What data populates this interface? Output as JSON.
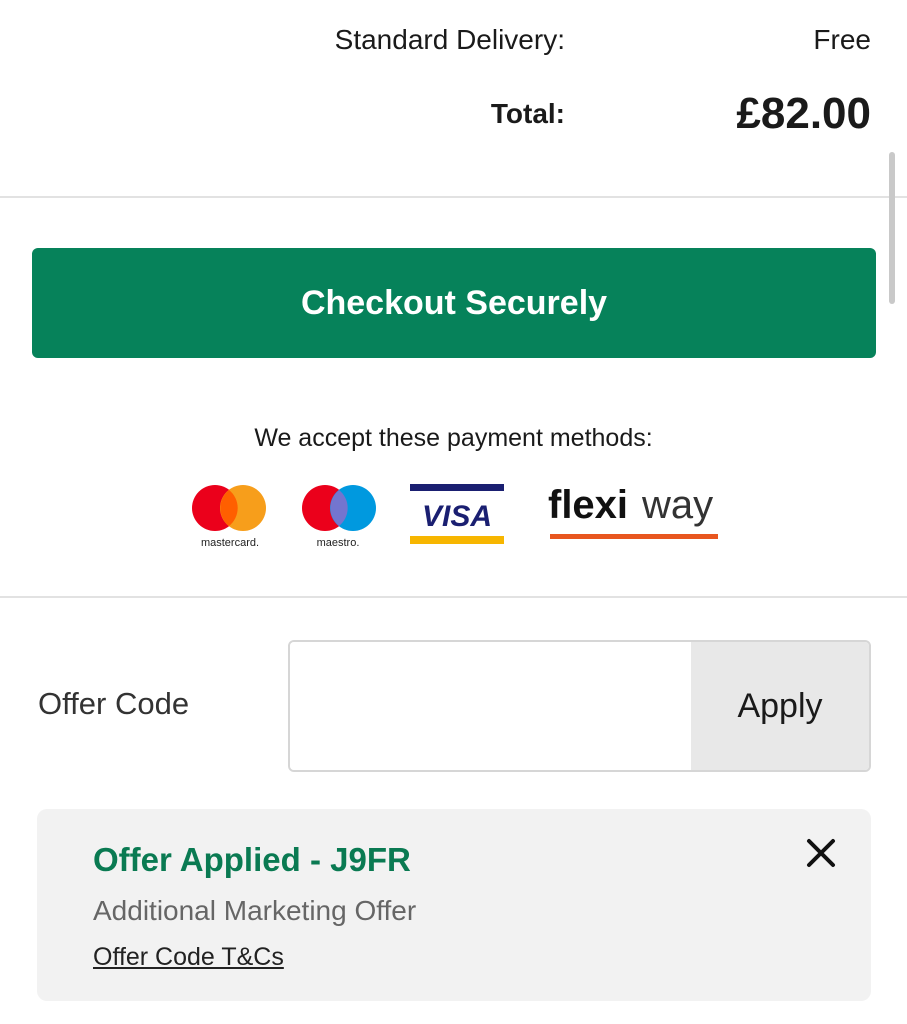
{
  "summary": {
    "delivery_label": "Standard Delivery:",
    "delivery_value": "Free",
    "total_label": "Total:",
    "total_value": "£82.00"
  },
  "checkout": {
    "button_label": "Checkout Securely",
    "button_color": "#06825a"
  },
  "payment": {
    "heading": "We accept these payment methods:",
    "methods": [
      {
        "name": "mastercard",
        "icon": "mastercard-logo"
      },
      {
        "name": "maestro",
        "icon": "maestro-logo"
      },
      {
        "name": "VISA",
        "icon": "visa-logo"
      },
      {
        "name": "flexiway",
        "icon": "flexiway-logo"
      }
    ]
  },
  "offer": {
    "label": "Offer Code",
    "input_value": "",
    "input_placeholder": "",
    "apply_label": "Apply"
  },
  "applied_offer": {
    "title": "Offer Applied - J9FR",
    "description": "Additional Marketing Offer",
    "terms_link": "Offer Code T&Cs",
    "title_color": "#0a7a52",
    "close_icon": "close-icon"
  }
}
